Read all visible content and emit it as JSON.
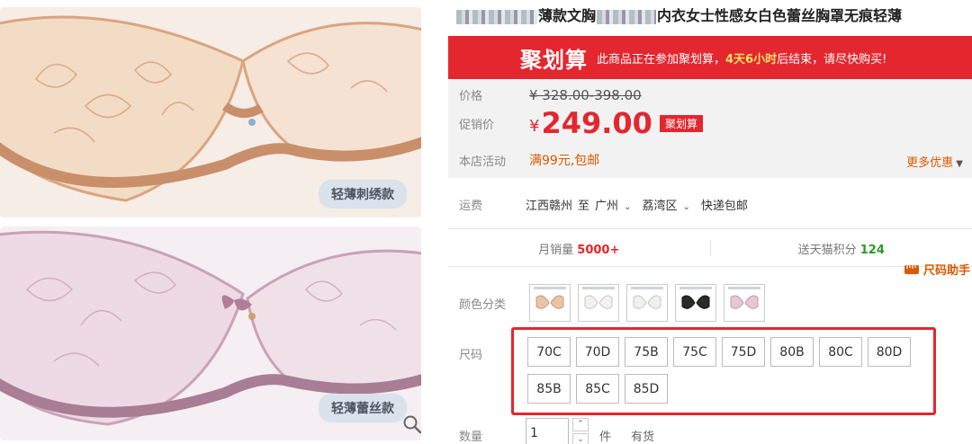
{
  "gallery": {
    "images": [
      {
        "caption": "轻薄刺绣款"
      },
      {
        "caption": "轻薄蕾丝款"
      }
    ],
    "zoom_icon": "search-icon"
  },
  "product": {
    "title_visible_1": "薄款文胸",
    "title_visible_2": "内衣女士性感女白色蕾丝胸罩无痕轻薄"
  },
  "juhuasuan": {
    "logo": "聚划算",
    "notice_prefix": "此商品正在参加聚划算，",
    "notice_time": "4天6小时",
    "notice_suffix": "后结束，请尽快购买!"
  },
  "price": {
    "orig_label": "价格",
    "orig_value": "¥ 328.00-398.00",
    "promo_label": "促销价",
    "currency": "¥",
    "promo_value": "249.00",
    "promo_badge": "聚划算",
    "activity_label": "本店活动",
    "activity_value": "满99元,包邮",
    "more_label": "更多优惠"
  },
  "shipping": {
    "label": "运费",
    "from": "江西赣州",
    "to_word": "至",
    "city": "广州",
    "district": "荔湾区",
    "method": "快递包邮"
  },
  "stats": {
    "sales_label": "月销量",
    "sales_value": "5000+",
    "points_label": "送天猫积分",
    "points_value": "124"
  },
  "size_helper": {
    "label": "尺码助手",
    "icon": "ruler-icon"
  },
  "color": {
    "label": "颜色分类",
    "swatches": [
      {
        "name": "nude",
        "color": "#e8c4a8"
      },
      {
        "name": "white-1",
        "color": "#f4f2f0"
      },
      {
        "name": "white-2",
        "color": "#f0f0f0"
      },
      {
        "name": "black",
        "color": "#2a2a2a"
      },
      {
        "name": "pink",
        "color": "#e8c6d4"
      }
    ]
  },
  "size": {
    "label": "尺码",
    "options": [
      "70C",
      "70D",
      "75B",
      "75C",
      "75D",
      "80B",
      "80C",
      "80D",
      "85B",
      "85C",
      "85D"
    ],
    "highlight_color": "#e4262f"
  },
  "quantity": {
    "label": "数量",
    "value": "1",
    "unit": "件",
    "stock": "有货"
  }
}
